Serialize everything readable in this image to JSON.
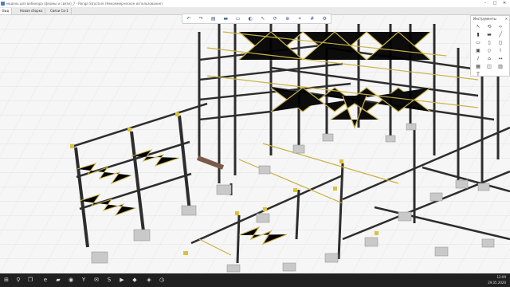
{
  "window": {
    "title": "модель для вебинара (фермы и связи)_7 - Renga Structure (Некоммерческое использование)",
    "min_glyph": "–",
    "max_glyph": "□",
    "close_glyph": "✕"
  },
  "tabs": [
    {
      "label": "Вид"
    },
    {
      "label": "Новая сборка"
    },
    {
      "label": "Связи Св-1"
    }
  ],
  "palette": {
    "title": "Инструменты",
    "close_glyph": "×"
  },
  "clock": {
    "time": "12:09",
    "date": "29.05.2020"
  },
  "colors": {
    "steel": "#2d2d2d",
    "bracing": "#c8b040",
    "connection": "#d9c23a",
    "foundation": "#c9c9c9",
    "taskbar": "#202020"
  }
}
